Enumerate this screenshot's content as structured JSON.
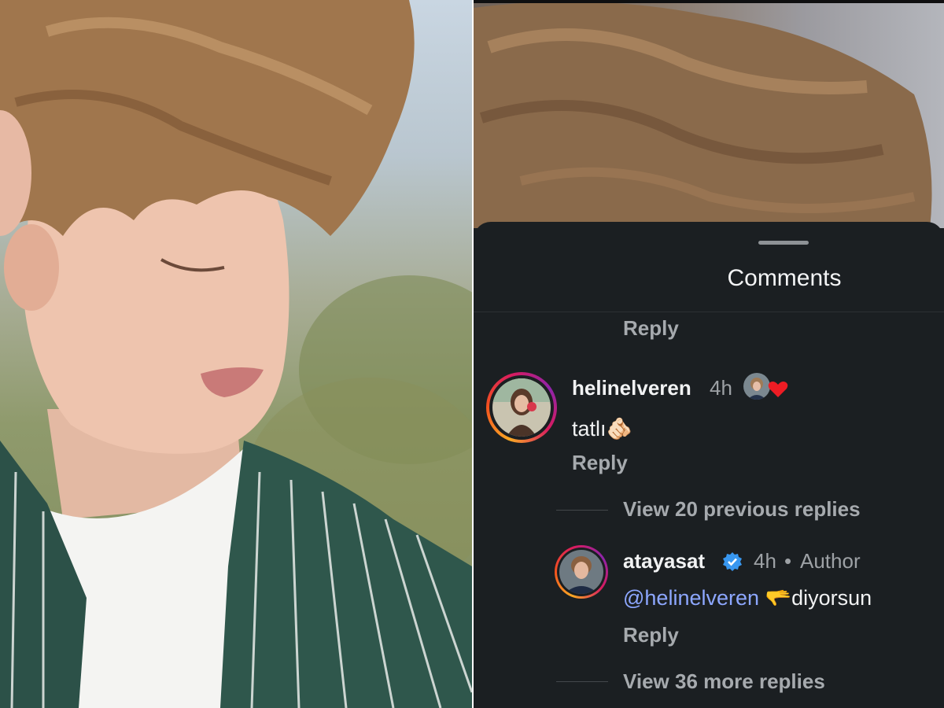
{
  "sheet": {
    "title": "Comments",
    "top_reply_label": "Reply"
  },
  "comments": [
    {
      "username": "helinelveren",
      "time": "4h",
      "text": "tatlı🫵🏻",
      "reply_label": "Reply",
      "liked_by_author_icon": "heart-icon"
    }
  ],
  "thread": {
    "view_previous_label": "View 20 previous replies",
    "reply": {
      "username": "atayasat",
      "verified_icon": "verified-badge-icon",
      "time": "4h",
      "dot": "•",
      "author_label": "Author",
      "mention": "@helinelveren",
      "text": " 🫳diyorsun",
      "reply_label": "Reply"
    },
    "view_more_label": "View 36 more replies"
  },
  "colors": {
    "background": "#1b1f22",
    "mention": "#8da7ff",
    "verified": "#3897f0",
    "heart": "#ed1c24"
  }
}
